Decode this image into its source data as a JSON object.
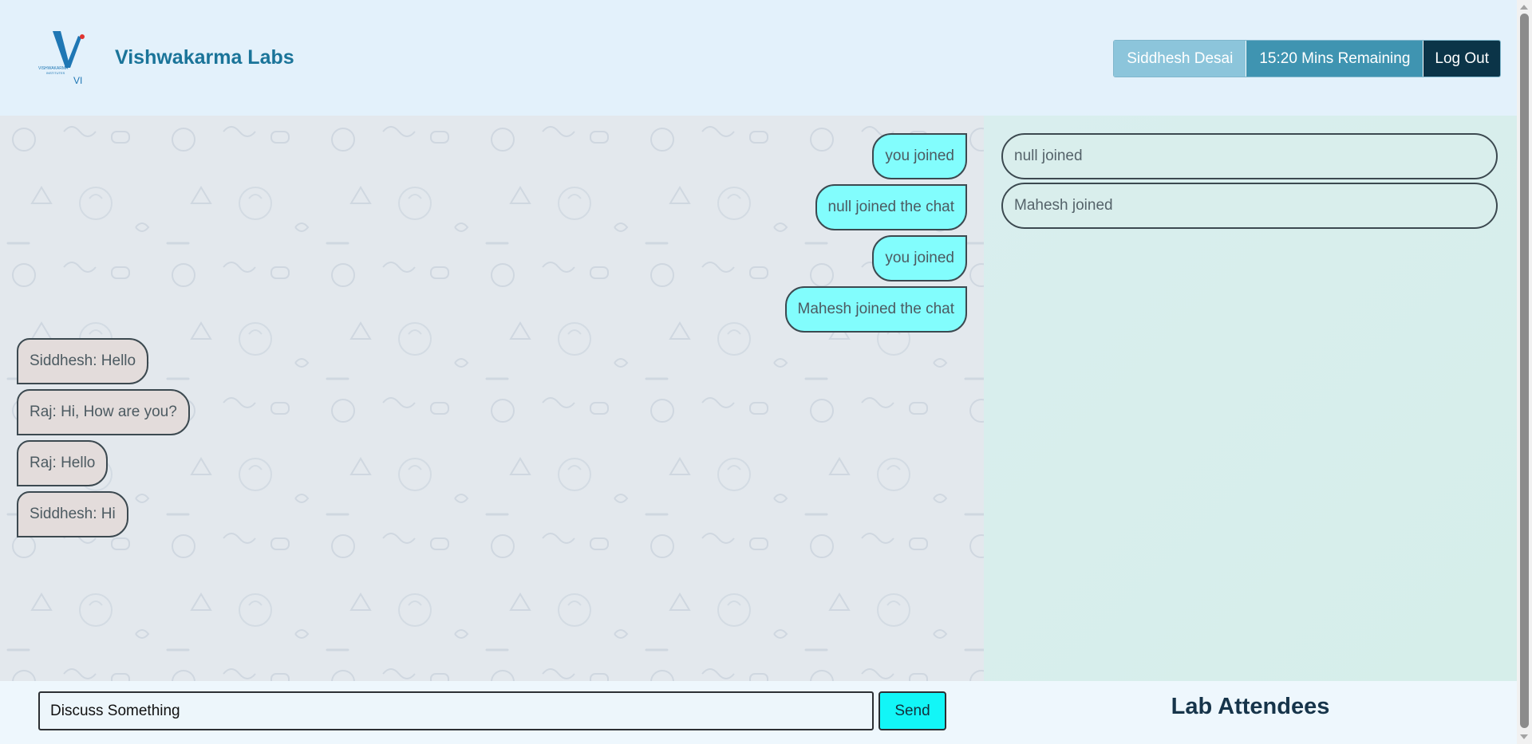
{
  "header": {
    "brand": "Vishwakarma Labs",
    "logo_text": "VISHWAKARMA INSTITUTES",
    "logo_mark": "VI",
    "user_name": "Siddhesh Desai",
    "timer": "15:20 Mins Remaining",
    "logout_label": "Log Out"
  },
  "chat": {
    "sent": [
      {
        "text": "you joined"
      },
      {
        "text": "null joined the chat"
      },
      {
        "text": "you joined"
      },
      {
        "text": "Mahesh joined the chat"
      }
    ],
    "received": [
      {
        "text": "Siddhesh: Hello"
      },
      {
        "text": "Raj: Hi, How are you?"
      },
      {
        "text": "Raj: Hello"
      },
      {
        "text": "Siddhesh: Hi"
      }
    ]
  },
  "attendees": {
    "title": "Lab Attendees",
    "items": [
      {
        "text": "null joined"
      },
      {
        "text": "Mahesh joined"
      }
    ]
  },
  "composer": {
    "value": "Discuss Something",
    "send_label": "Send"
  },
  "colors": {
    "accent": "#1a7499",
    "sent_bubble": "#82fdfd",
    "received_bubble": "#e3dcdb",
    "send_button": "#12f6f7",
    "logout": "#0b3448"
  }
}
